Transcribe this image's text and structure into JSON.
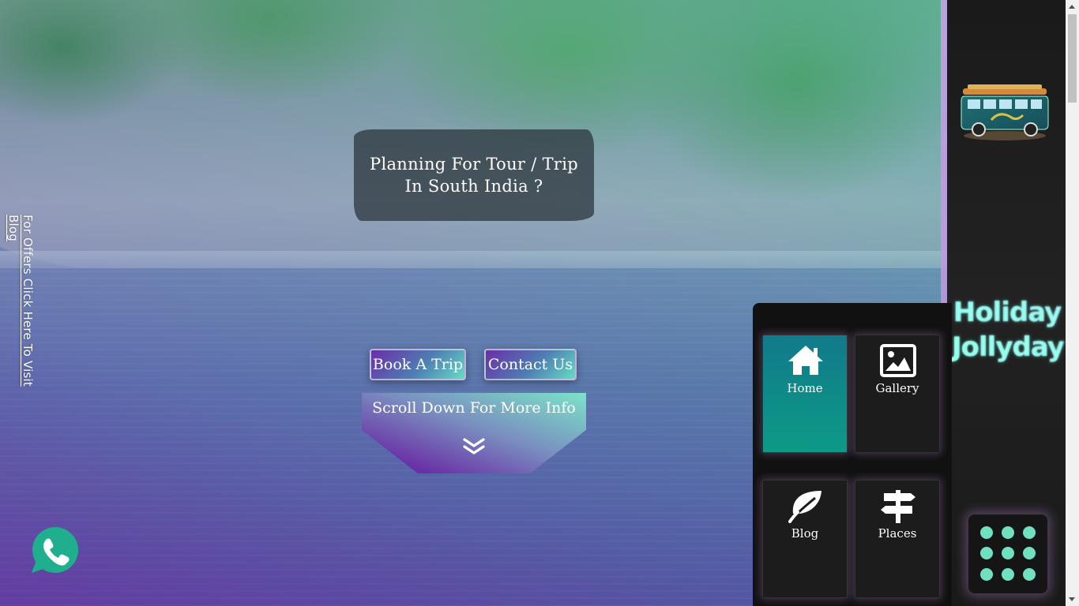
{
  "headline": {
    "line1": "Planning For Tour / Trip",
    "line2": "In South India ?"
  },
  "side_link": {
    "text": "For Offers Click Here To Visit Blog"
  },
  "buttons": {
    "book": "Book A Trip",
    "contact": "Contact Us"
  },
  "scroll_banner": {
    "label": "Scroll Down For More Info",
    "icon": "double-chevron-down-icon"
  },
  "brand": {
    "word1": "Holiday",
    "word2": "Jollyday"
  },
  "nav": {
    "items": [
      {
        "label": "Home",
        "icon": "home-icon",
        "active": true
      },
      {
        "label": "Gallery",
        "icon": "image-icon",
        "active": false
      },
      {
        "label": "Blog",
        "icon": "leaf-icon",
        "active": false
      },
      {
        "label": "Places",
        "icon": "signpost-icon",
        "active": false
      }
    ]
  },
  "floating": {
    "phone_icon": "phone-icon",
    "menu_icon": "grid-dots-icon"
  },
  "colors": {
    "accent_teal": "#6fe0c0",
    "accent_purple": "#6a2ea8",
    "sidebar_bg": "#1a1a1a",
    "active_tile": "#0d9a86"
  }
}
